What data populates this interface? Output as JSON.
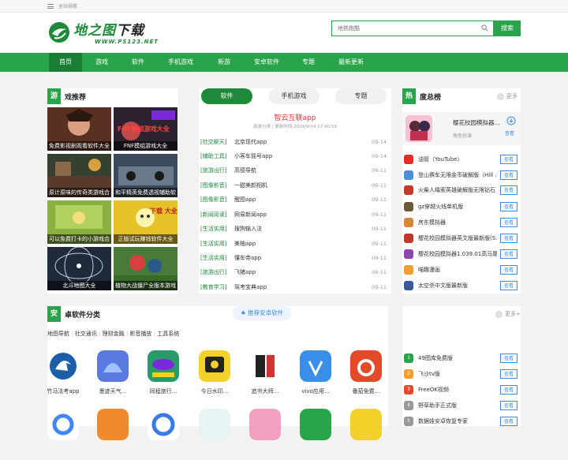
{
  "topbar": {
    "site_nav": "全站导航"
  },
  "logo": {
    "title_main": "地之图",
    "title_dl": "下载",
    "url": "WWW.PS123.NET"
  },
  "search": {
    "placeholder": "地铁跑酷",
    "button": "搜索"
  },
  "nav": [
    "首页",
    "游戏",
    "软件",
    "手机游戏",
    "新游",
    "安卓软件",
    "专题",
    "最新更新"
  ],
  "games": {
    "badge": "游",
    "title": "戏推荐",
    "items": [
      {
        "caption": "免费影视剧观看软件大全",
        "color": "#7a4a3a"
      },
      {
        "caption": "FNF模组游戏大全",
        "color": "#2c2230",
        "overlay": "FNF模组游戏大全"
      },
      {
        "caption": "原计原味的传奇类游戏合",
        "color": "#35402e"
      },
      {
        "caption": "和平精英免费透视辅助软",
        "color": "#3b4a5e"
      },
      {
        "caption": "可以免费打卡的小游戏合",
        "color": "#6a8a3a"
      },
      {
        "caption": "正版试玩赚钱软件大全",
        "color": "#e6c229",
        "overlay": "下载 大全"
      },
      {
        "caption": "北斗地图大全",
        "color": "#1f2a3a"
      },
      {
        "caption": "植物大战僵尸全版本游戏",
        "color": "#4a7a3a"
      }
    ]
  },
  "center": {
    "tabs": [
      "软件",
      "手机游戏",
      "专题"
    ],
    "featured_title": "智云互联app",
    "featured_meta": "原游分类 | 更新时间:2024/9/14 17:40:59",
    "news": [
      {
        "cat": "[社交聊天]",
        "title": "北京现代app",
        "date": "09-14"
      },
      {
        "cat": "[辅助工具]",
        "title": "小客车摇号app",
        "date": "09-14"
      },
      {
        "cat": "[旅游出行]",
        "title": "高德导航",
        "date": "09-11"
      },
      {
        "cat": "[图像影音]",
        "title": "一甜美颜相机",
        "date": "09-11"
      },
      {
        "cat": "[图像影音]",
        "title": "醒图app",
        "date": "09-11"
      },
      {
        "cat": "[新闻阅读]",
        "title": "网易新闻app",
        "date": "09-11"
      },
      {
        "cat": "[生活实用]",
        "title": "搜狗输入法",
        "date": "09-11"
      },
      {
        "cat": "[生活实用]",
        "title": "美柚app",
        "date": "09-11"
      },
      {
        "cat": "[生活实用]",
        "title": "懂车帝app",
        "date": "09-11"
      },
      {
        "cat": "[旅游出行]",
        "title": "飞猪app",
        "date": "09-11"
      },
      {
        "cat": "[教育学习]",
        "title": "驾考宝典app",
        "date": "09-11"
      }
    ]
  },
  "rank": {
    "badge": "热",
    "title": "度总榜",
    "more": "更多",
    "top": {
      "name": "樱花校园模拟器...",
      "category": "角色扮演",
      "btn": "查看"
    },
    "items": [
      {
        "name": "油管（YouTube）",
        "color": "#e52d27",
        "btn": "查看"
      },
      {
        "name": "登山赛车无限金币破解版（Hill ...",
        "color": "#4a8fd8",
        "btn": "查看"
      },
      {
        "name": "火柴人绳索英雄破解版无限钻石",
        "color": "#c23a2a",
        "btn": "查看"
      },
      {
        "name": "gz穿越火线单机版",
        "color": "#6a5a3a",
        "btn": "查看"
      },
      {
        "name": "房东模拟器",
        "color": "#d8873a",
        "btn": "查看"
      },
      {
        "name": "樱花校园模拟器英文版最新版(S...",
        "color": "#c0392b",
        "btn": "查看"
      },
      {
        "name": "樱花校园模拟器1.039.01高马尾...",
        "color": "#8e44ad",
        "btn": "查看"
      },
      {
        "name": "喵趣漫画",
        "color": "#f0a030",
        "btn": "查看"
      },
      {
        "name": "太空杀中文版最新版",
        "color": "#3b5998",
        "btn": "查看"
      }
    ]
  },
  "android": {
    "badge": "安",
    "title": "卓软件分类",
    "pill": "推荐安卓软件",
    "more": "更多+",
    "cats": [
      "地图导航",
      "社交通讯",
      "理财金融",
      "影音播放",
      "工具系统"
    ],
    "apps": [
      {
        "name": "竹马法考app",
        "color": "#1a5fa8"
      },
      {
        "name": "墨迹天气...",
        "color": "#5a7ae0"
      },
      {
        "name": "同程旅行...",
        "color": "#2a9a6a"
      },
      {
        "name": "今日水印...",
        "color": "#f2d12a"
      },
      {
        "name": "追书大师...",
        "color": "#ffffff"
      },
      {
        "name": "vivo应用...",
        "color": "#3a8ee8"
      },
      {
        "name": "番茄免费...",
        "color": "#e24a2a"
      }
    ],
    "apps_row2": [
      {
        "color": "#ffffff"
      },
      {
        "color": "#f08a2a"
      },
      {
        "color": "#3a7ae8"
      },
      {
        "color": "#2aa4a4"
      },
      {
        "color": "#f0a0c0"
      },
      {
        "color": "#2aa44a"
      },
      {
        "color": "#f2d12a"
      }
    ]
  },
  "rank2": {
    "items": [
      {
        "num": "1",
        "name": "49图库免费版",
        "btn": "查看",
        "color": "#2aa44a"
      },
      {
        "num": "2",
        "name": "飞沙tv版",
        "btn": "查看",
        "color": "#f0a030"
      },
      {
        "num": "3",
        "name": "FreeOK视频",
        "btn": "查看",
        "color": "#e24a2a"
      },
      {
        "num": "4",
        "name": "野草助手正式版",
        "btn": "查看",
        "color": "#4a8fd8"
      },
      {
        "num": "5",
        "name": "数据娃安卓恢复专家",
        "btn": "查看",
        "color": "#2aa4a4"
      }
    ]
  }
}
